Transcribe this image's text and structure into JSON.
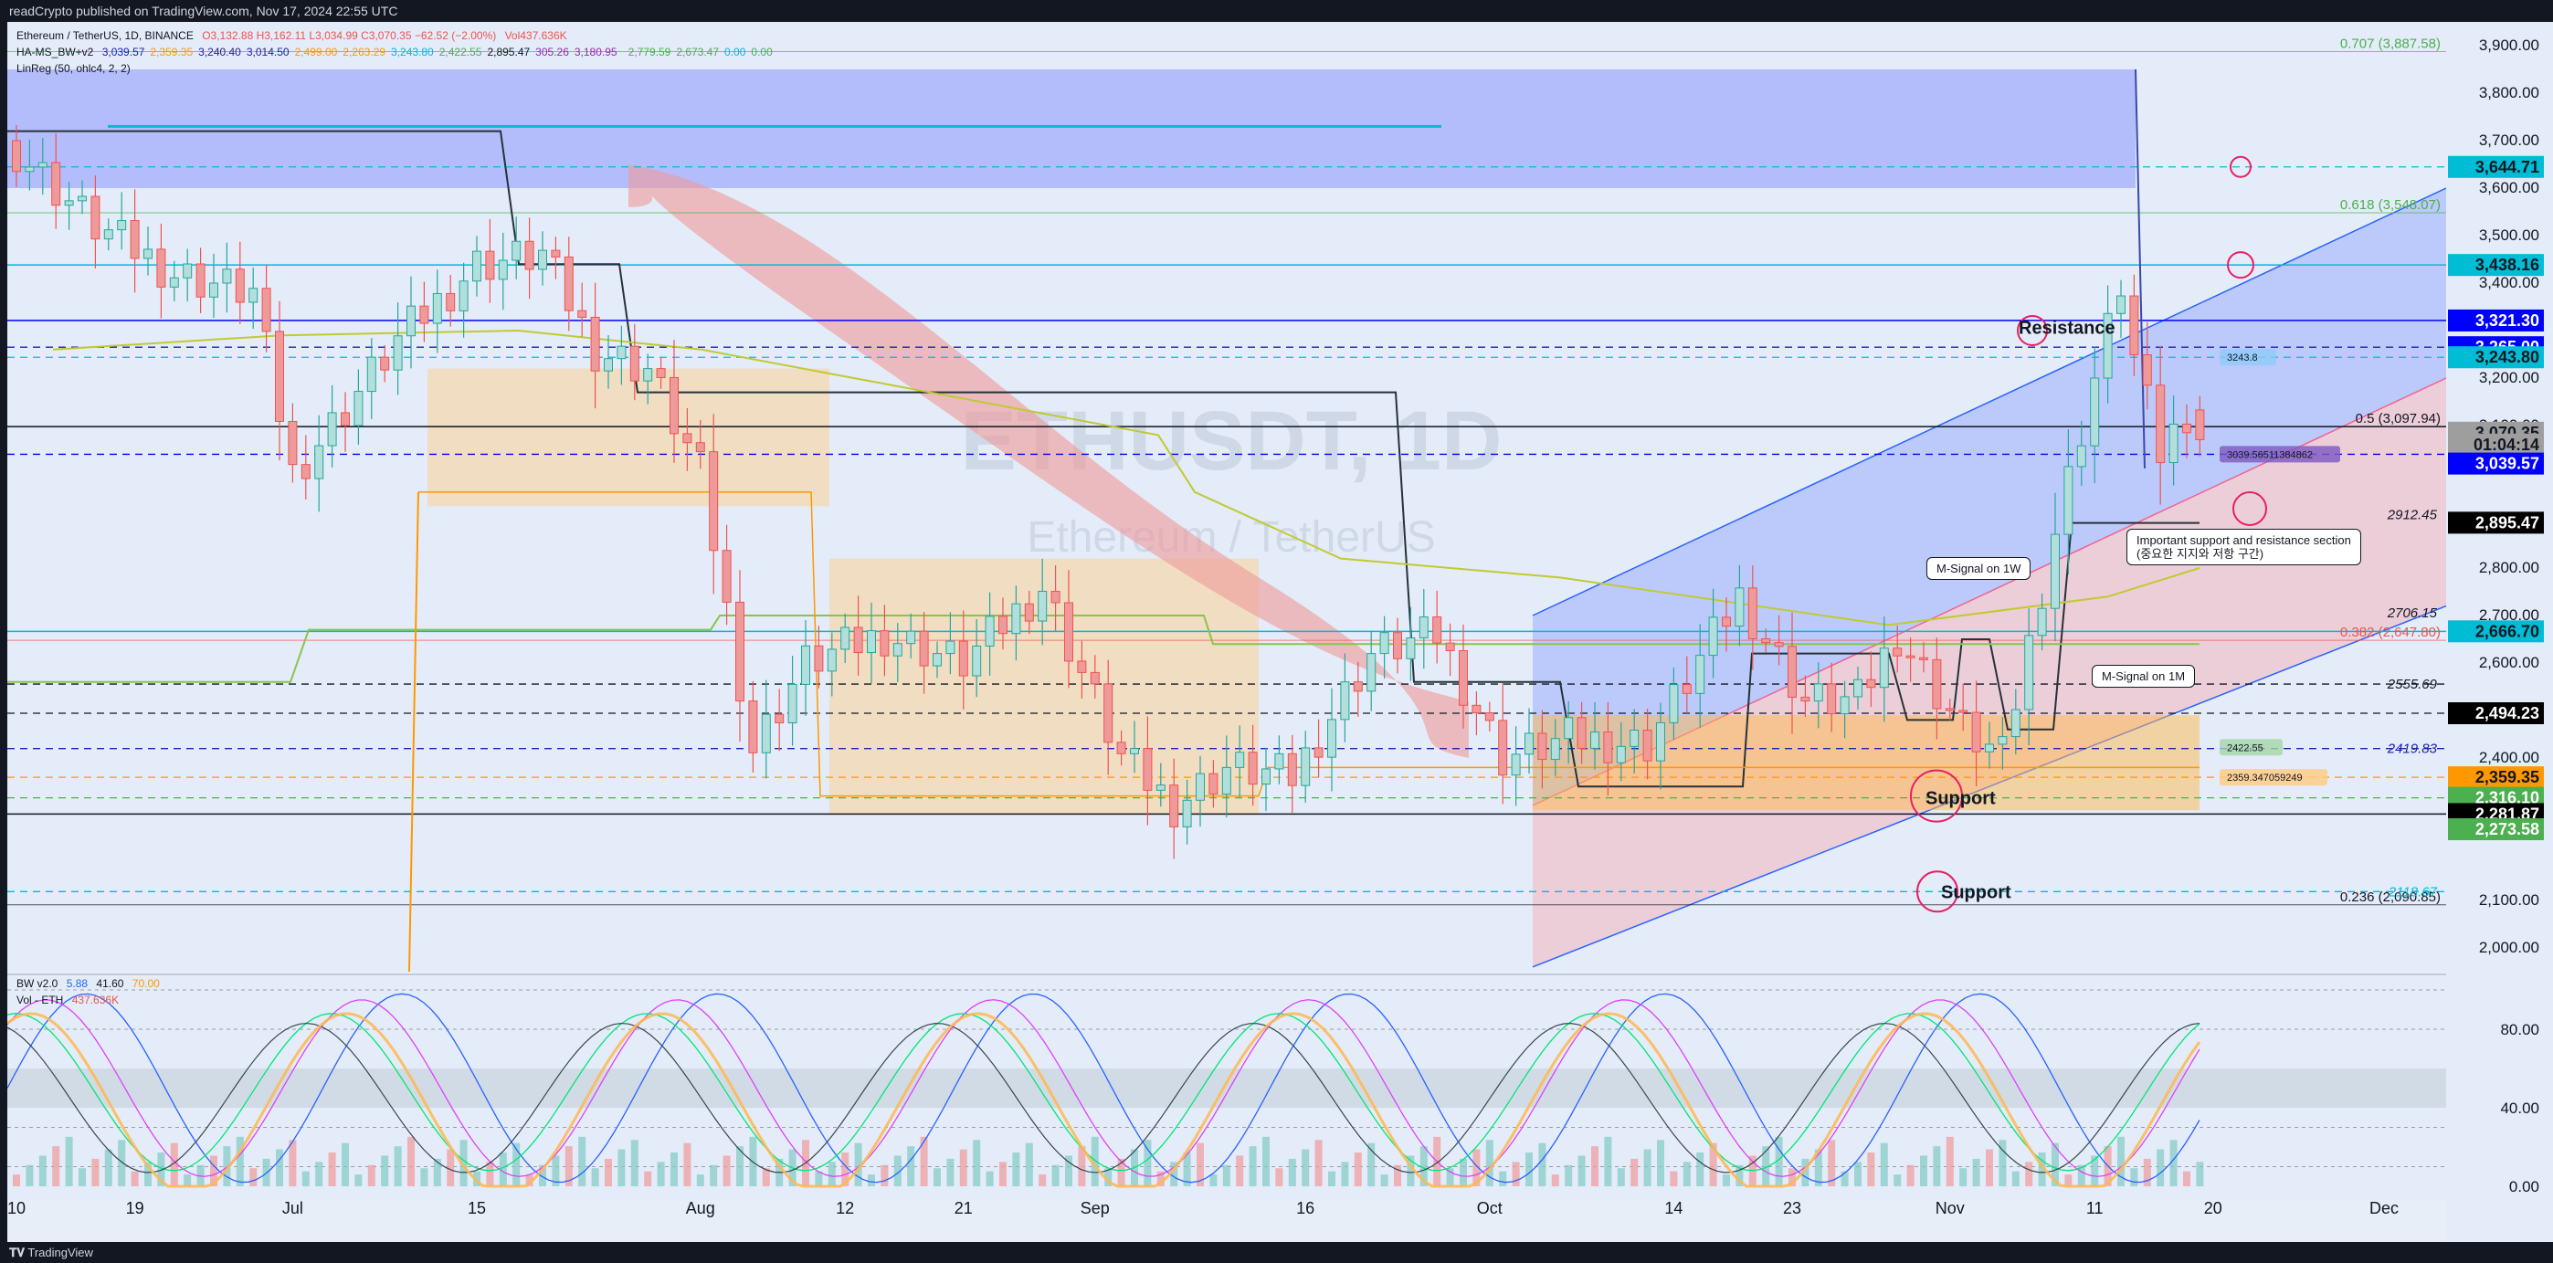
{
  "header": {
    "publisher_line": "readCrypto published on TradingView.com, Nov 17, 2024 22:55 UTC"
  },
  "legends": {
    "main": {
      "symbol": "Ethereum / TetherUS, 1D, BINANCE",
      "ohlc": "O3,132.88 H3,162.11 L3,034.99 C3,070.35 −62.52 (−2.00%)",
      "volume": "Vol437.636K"
    },
    "ha_ms_bw": {
      "name": "HA-MS_BW+v2",
      "values": [
        "3,039.57",
        "2,359.35",
        "3,240.40",
        "3,014.50",
        "2,499.00",
        "2,263.29",
        "3,243.80",
        "2,422.55",
        "2,895.47",
        "305.26",
        "3,180.95",
        "",
        "2,779.59",
        "2,673.47",
        "0.00",
        "0.00"
      ],
      "colors": [
        "#1e22aa",
        "#ff9800",
        "#1e22aa",
        "#1e22aa",
        "#ff9800",
        "#ff9800",
        "#00bcd4",
        "#4caf50",
        "#131722",
        "#9c27b0",
        "#9c27b0",
        "#cddc39",
        "#4caf50",
        "#4caf50",
        "#00bcd4",
        "#4caf50"
      ]
    },
    "linreg": {
      "name": "LinReg (50, ohlc4, 2, 2)"
    },
    "bw": {
      "name": "BW v2.0",
      "values": [
        "5.88",
        "41.60",
        "70.00"
      ],
      "colors": [
        "#2962ff",
        "#131722",
        "#ff9800"
      ]
    },
    "vol": {
      "name": "Vol - ETH",
      "value": "437.636K",
      "color": "#ef5350"
    }
  },
  "watermark": {
    "symbol": "ETHUSDT, 1D",
    "name": "Ethereum / TetherUS"
  },
  "price_axis": {
    "ticks": [
      "3,900.00",
      "3,800.00",
      "3,700.00",
      "3,600.00",
      "3,500.00",
      "3,400.00",
      "3,200.00",
      "3,100.00",
      "2,800.00",
      "2,700.00",
      "2,600.00",
      "2,400.00",
      "2,100.00",
      "2,000.00"
    ],
    "tick_values": [
      3900,
      3800,
      3700,
      3600,
      3500,
      3400,
      3200,
      3100,
      2800,
      2700,
      2600,
      2400,
      2100,
      2000
    ],
    "labels": [
      {
        "text": "3,644.71",
        "value": 3644.71,
        "bg": "#00bcd4",
        "fg": "#131722"
      },
      {
        "text": "3,438.16",
        "value": 3438.16,
        "bg": "#00bcd4",
        "fg": "#131722"
      },
      {
        "text": "3,321.30",
        "value": 3321.3,
        "bg": "#0000ff",
        "fg": "#ffffff"
      },
      {
        "text": "3,265.00",
        "value": 3265.0,
        "bg": "#0000ff",
        "fg": "#ffffff"
      },
      {
        "text": "3,243.80",
        "value": 3243.8,
        "bg": "#00bcd4",
        "fg": "#131722"
      },
      {
        "text": "3,070.35",
        "value": 3085,
        "bg": "#9e9e9e",
        "fg": "#131722"
      },
      {
        "text": "01:04:14",
        "value": 3060,
        "bg": "#9e9e9e",
        "fg": "#131722"
      },
      {
        "text": "3,039.57",
        "value": 3020,
        "bg": "#0000ff",
        "fg": "#ffffff"
      },
      {
        "text": "2,895.47",
        "value": 2895.47,
        "bg": "#000000",
        "fg": "#ffffff"
      },
      {
        "text": "2,666.70",
        "value": 2666.7,
        "bg": "#00bcd4",
        "fg": "#131722"
      },
      {
        "text": "2,494.23",
        "value": 2494.23,
        "bg": "#000000",
        "fg": "#ffffff"
      },
      {
        "text": "2,359.35",
        "value": 2359.35,
        "bg": "#ff9800",
        "fg": "#131722"
      },
      {
        "text": "2,316.10",
        "value": 2316.1,
        "bg": "#4caf50",
        "fg": "#ffffff"
      },
      {
        "text": "2,281.87",
        "value": 2281.87,
        "bg": "#000000",
        "fg": "#ffffff"
      },
      {
        "text": "2,273.58",
        "value": 2250,
        "bg": "#4caf50",
        "fg": "#ffffff"
      }
    ]
  },
  "osc_axis": {
    "ticks": [
      "80.00",
      "40.00",
      "0.00"
    ],
    "tick_values": [
      80,
      40,
      0
    ]
  },
  "time_axis": {
    "labels": [
      "10",
      "19",
      "Jul",
      "15",
      "Aug",
      "12",
      "21",
      "Sep",
      "16",
      "Oct",
      "14",
      "23",
      "Nov",
      "11",
      "20",
      "Dec"
    ],
    "day_index": [
      0,
      9,
      21,
      35,
      52,
      63,
      72,
      82,
      98,
      112,
      126,
      135,
      147,
      158,
      167,
      180
    ]
  },
  "fib_levels": [
    {
      "text": "0.707 (3,887.58)",
      "value": 3887.58,
      "color": "#4caf50"
    },
    {
      "text": "0.618 (3,548.07)",
      "value": 3548.07,
      "color": "#4caf50"
    },
    {
      "text": "0.5 (3,097.94)",
      "value": 3097.94,
      "color": "#131722"
    },
    {
      "text": "0.382 (2,647.80)",
      "value": 2647.8,
      "color": "#ef5350"
    },
    {
      "text": "0.236 (2,090.85)",
      "value": 2090.85,
      "color": "#131722"
    }
  ],
  "horizontal_levels": [
    {
      "text": "2912.45",
      "value": 2912.45,
      "color": "#131722",
      "style": "dash"
    },
    {
      "text": "2706.15",
      "value": 2706.15,
      "color": "#131722",
      "style": "dash"
    },
    {
      "text": "2555.69",
      "value": 2555.69,
      "color": "#131722",
      "style": "dash"
    },
    {
      "text": "2419.83",
      "value": 2419.83,
      "color": "#1e22aa",
      "style": "dash"
    },
    {
      "text": "2118.67",
      "value": 2118.67,
      "color": "#00bcd4",
      "style": "dash"
    }
  ],
  "chart_boxes": [
    {
      "text": "3243.8",
      "value": 3243.8,
      "bg": "#90caf9"
    },
    {
      "text": "3039.56511384862",
      "value": 3039.57,
      "bg": "#7e57c2"
    },
    {
      "text": "2422.55",
      "value": 2422.55,
      "bg": "#a5d6a7"
    },
    {
      "text": "2359.347059249",
      "value": 2359.35,
      "bg": "#ffcc80"
    }
  ],
  "annotations": {
    "resistance": "Resistance",
    "support_1": "Support",
    "support_2": "Support",
    "m_signal_1w": "M-Signal on 1W",
    "m_signal_1m": "M-Signal on 1M",
    "important_line1": "Important support and resistance section",
    "important_line2": "(중요한 지지와 저항 구간)"
  },
  "footer": {
    "brand": "TradingView"
  },
  "chart_data": {
    "type": "candlestick",
    "symbol": "ETHUSDT",
    "interval": "1D",
    "y_range": [
      1950,
      3950
    ],
    "start_date": "2024-06-10",
    "last_candle": {
      "open": 3132.88,
      "high": 3162.11,
      "low": 3034.99,
      "close": 3070.35
    },
    "close_series_anchors": [
      {
        "d": 0,
        "c": 3680
      },
      {
        "d": 6,
        "c": 3520
      },
      {
        "d": 12,
        "c": 3420
      },
      {
        "d": 18,
        "c": 3380
      },
      {
        "d": 21,
        "c": 3000
      },
      {
        "d": 24,
        "c": 3100
      },
      {
        "d": 29,
        "c": 3280
      },
      {
        "d": 35,
        "c": 3440
      },
      {
        "d": 40,
        "c": 3460
      },
      {
        "d": 44,
        "c": 3260
      },
      {
        "d": 48,
        "c": 3220
      },
      {
        "d": 52,
        "c": 3000
      },
      {
        "d": 56,
        "c": 2420
      },
      {
        "d": 60,
        "c": 2600
      },
      {
        "d": 66,
        "c": 2660
      },
      {
        "d": 72,
        "c": 2600
      },
      {
        "d": 78,
        "c": 2760
      },
      {
        "d": 84,
        "c": 2400
      },
      {
        "d": 88,
        "c": 2300
      },
      {
        "d": 92,
        "c": 2380
      },
      {
        "d": 97,
        "c": 2360
      },
      {
        "d": 103,
        "c": 2620
      },
      {
        "d": 108,
        "c": 2660
      },
      {
        "d": 113,
        "c": 2400
      },
      {
        "d": 118,
        "c": 2440
      },
      {
        "d": 124,
        "c": 2430
      },
      {
        "d": 131,
        "c": 2740
      },
      {
        "d": 136,
        "c": 2520
      },
      {
        "d": 140,
        "c": 2520
      },
      {
        "d": 143,
        "c": 2660
      },
      {
        "d": 148,
        "c": 2460
      },
      {
        "d": 151,
        "c": 2400
      },
      {
        "d": 155,
        "c": 2880
      },
      {
        "d": 158,
        "c": 3200
      },
      {
        "d": 160,
        "c": 3400
      },
      {
        "d": 161,
        "c": 3240
      },
      {
        "d": 163,
        "c": 3040
      },
      {
        "d": 165,
        "c": 3130
      },
      {
        "d": 166,
        "c": 3070
      }
    ],
    "colors": {
      "up": "#26a69a",
      "down": "#ef5350"
    }
  }
}
